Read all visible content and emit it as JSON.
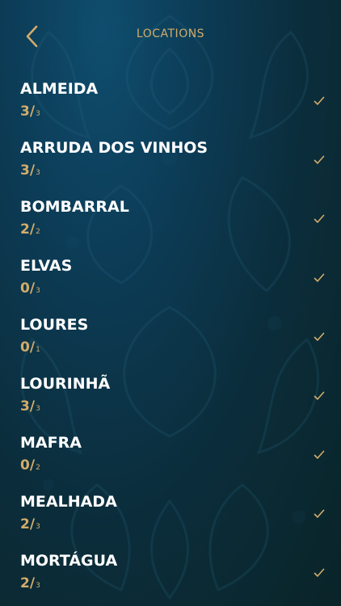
{
  "header": {
    "title": "LOCATIONS",
    "back_icon": "chevron-left-icon"
  },
  "colors": {
    "accent": "#d2ac6a",
    "text": "#ffffff",
    "background_top": "#0f4d6e",
    "background_bottom": "#0a2428"
  },
  "locations": [
    {
      "name": "ALMEIDA",
      "found": "3",
      "total": "3",
      "icon": "checkmark-icon"
    },
    {
      "name": "ARRUDA DOS VINHOS",
      "found": "3",
      "total": "3",
      "icon": "checkmark-icon"
    },
    {
      "name": "BOMBARRAL",
      "found": "2",
      "total": "2",
      "icon": "checkmark-icon"
    },
    {
      "name": "ELVAS",
      "found": "0",
      "total": "3",
      "icon": "checkmark-icon"
    },
    {
      "name": "LOURES",
      "found": "0",
      "total": "1",
      "icon": "checkmark-icon"
    },
    {
      "name": "LOURINHÃ",
      "found": "3",
      "total": "3",
      "icon": "checkmark-icon"
    },
    {
      "name": "MAFRA",
      "found": "0",
      "total": "2",
      "icon": "checkmark-icon"
    },
    {
      "name": "MEALHADA",
      "found": "2",
      "total": "3",
      "icon": "checkmark-icon"
    },
    {
      "name": "MORTÁGUA",
      "found": "2",
      "total": "3",
      "icon": "checkmark-icon"
    }
  ]
}
